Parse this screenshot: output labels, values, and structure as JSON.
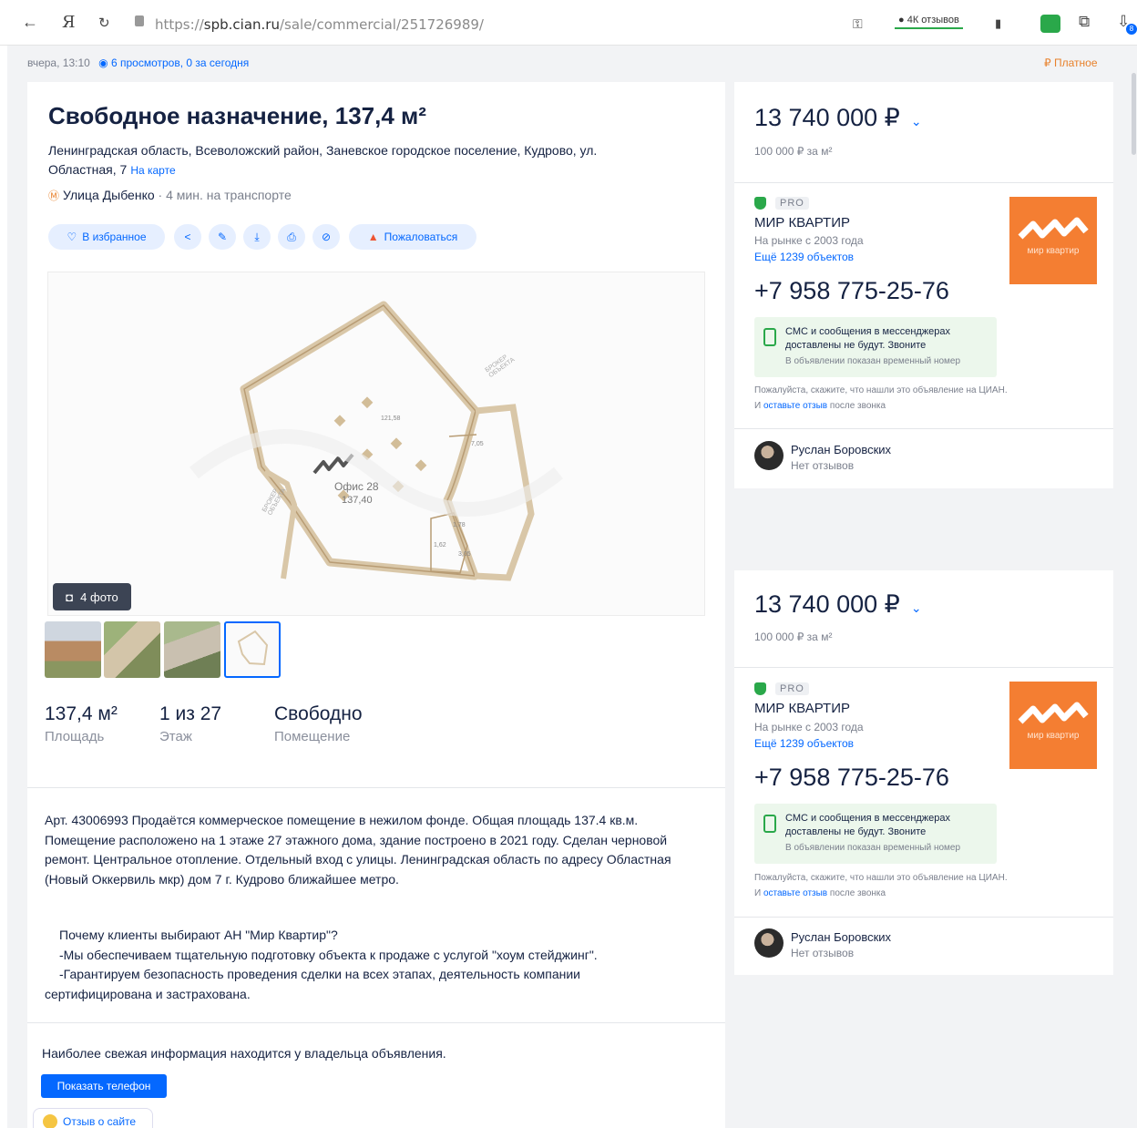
{
  "browser": {
    "url_prefix": "https://",
    "url_host": "spb.cian.ru",
    "url_path": "/sale/commercial/251726989/",
    "reviews_badge": "4К отзывов",
    "badge_count": "8"
  },
  "meta": {
    "posted": "вчера, 13:10",
    "views": "6 просмотров, 0 за сегодня",
    "paid": "Платное"
  },
  "listing": {
    "title": "Свободное назначение, 137,4 м²",
    "address_line1": "Ленинградская область, Всеволожский район, Заневское городское поселение, Кудрово, ул.",
    "address_line2": "Областная, 7",
    "map_link": "На карте",
    "metro_station": "Улица Дыбенко",
    "metro_distance": "· 4 мин. на транспорте",
    "favorite_label": "В избранное",
    "report_label": "Пожаловаться"
  },
  "gallery": {
    "photo_count_label": "4 фото",
    "plan_label": "Офис 28",
    "plan_area": "137,40",
    "dims": [
      "121,58",
      "7,05",
      "1,78",
      "1,62",
      "3,05"
    ],
    "plan_notes": [
      "БРОКЕР ОБЪЕКТА",
      "БРОКЕР ОБЪЕКТА"
    ]
  },
  "stats": [
    {
      "value": "137,4 м²",
      "label": "Площадь"
    },
    {
      "value": "1 из 27",
      "label": "Этаж"
    },
    {
      "value": "Свободно",
      "label": "Помещение"
    }
  ],
  "description": {
    "main": "Арт. 43006993 Продаётся коммерческое помещение в нежилом фонде. Общая площадь 137.4 кв.м. Помещение расположено на 1 этаже 27 этажного дома, здание построено в 2021 году. Сделан черновой ремонт. Центральное отопление. Отдельный вход с улицы. Ленинградская область по адресу Областная (Новый Оккервиль мкр) дом 7 г. Кудрово ближайшее метро.",
    "why_line1": "Почему клиенты выбирают АН \"Мир Квартир\"?",
    "why_line2": "-Мы обеспечиваем тщательную подготовку объекта к продаже с услугой \"хоум стейджинг\".",
    "why_line3": "-Гарантируем безопасность проведения сделки на всех этапах, деятельность компании",
    "why_line4": "сертифицирована и застрахована."
  },
  "footer": {
    "fresh_info": "Наиболее свежая информация находится у владельца объявления.",
    "show_phone": "Показать телефон",
    "feedback": "Отзыв о сайте"
  },
  "seller": {
    "price": "13 740 000 ₽",
    "price_per_m2": "100 000 ₽ за м²",
    "pro": "PRO",
    "agency": "МИР КВАРТИР",
    "on_market": "На рынке с 2003 года",
    "more_objects": "Ещё 1239 объектов",
    "logo_name": "мир квартир",
    "phone": "+7 958 775-25-76",
    "sms_line1": "СМС и сообщения в мессенджерах доставлены не будут. Звоните",
    "sms_line2": "В объявлении показан временный номер",
    "note_part1": "Пожалуйста, скажите, что нашли это объявление на ЦИАН. И ",
    "note_link": "оставьте отзыв",
    "note_part2": " после звонка",
    "agent_name": "Руслан Боровских",
    "agent_reviews": "Нет отзывов"
  },
  "colors": {
    "accent": "#0468ff",
    "brand_orange": "#f47e32",
    "success": "#2aa84a",
    "text": "#152242",
    "muted": "#7a7f8c"
  }
}
